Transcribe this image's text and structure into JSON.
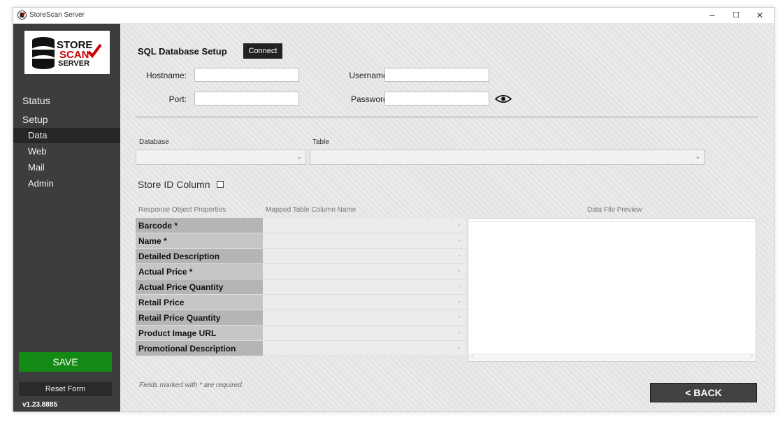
{
  "window": {
    "title": "StoreScan Server",
    "minimize": "–",
    "maximize": "☐",
    "close": "✕"
  },
  "logo": {
    "line1": "STORE",
    "line2": "SCAN",
    "line3": "SERVER"
  },
  "sidebar": {
    "headings": [
      "Status",
      "Setup"
    ],
    "items": [
      {
        "label": "Data"
      },
      {
        "label": "Web"
      },
      {
        "label": "Mail"
      },
      {
        "label": "Admin"
      }
    ],
    "save_label": "SAVE",
    "reset_label": "Reset Form",
    "version": "v1.23.8885"
  },
  "sql": {
    "title": "SQL Database Setup",
    "connect_label": "Connect",
    "hostname_label": "Hostname:",
    "port_label": "Port:",
    "username_label": "Username:",
    "password_label": "Password:",
    "hostname_value": "",
    "port_value": "",
    "username_value": "",
    "password_value": ""
  },
  "selectors": {
    "database_label": "Database",
    "table_label": "Table",
    "database_value": "",
    "table_value": ""
  },
  "store_id": {
    "label": "Store ID Column",
    "checked": false
  },
  "mapping": {
    "headers": [
      "Response Object Properties",
      "Mapped Table Column Name",
      "Data File Preview"
    ],
    "rows": [
      {
        "label": "Barcode *"
      },
      {
        "label": "Name *"
      },
      {
        "label": "Detailed Description"
      },
      {
        "label": "Actual Price *"
      },
      {
        "label": "Actual Price Quantity"
      },
      {
        "label": "Retail Price"
      },
      {
        "label": "Retail Price Quantity"
      },
      {
        "label": "Product Image URL"
      },
      {
        "label": "Promotional Description"
      }
    ]
  },
  "footer": {
    "note": "Fields marked with * are required.",
    "back_label": "< BACK"
  },
  "colors": {
    "save": "#138a13",
    "sidebar": "#3d3d3d",
    "active_item": "#262626"
  }
}
